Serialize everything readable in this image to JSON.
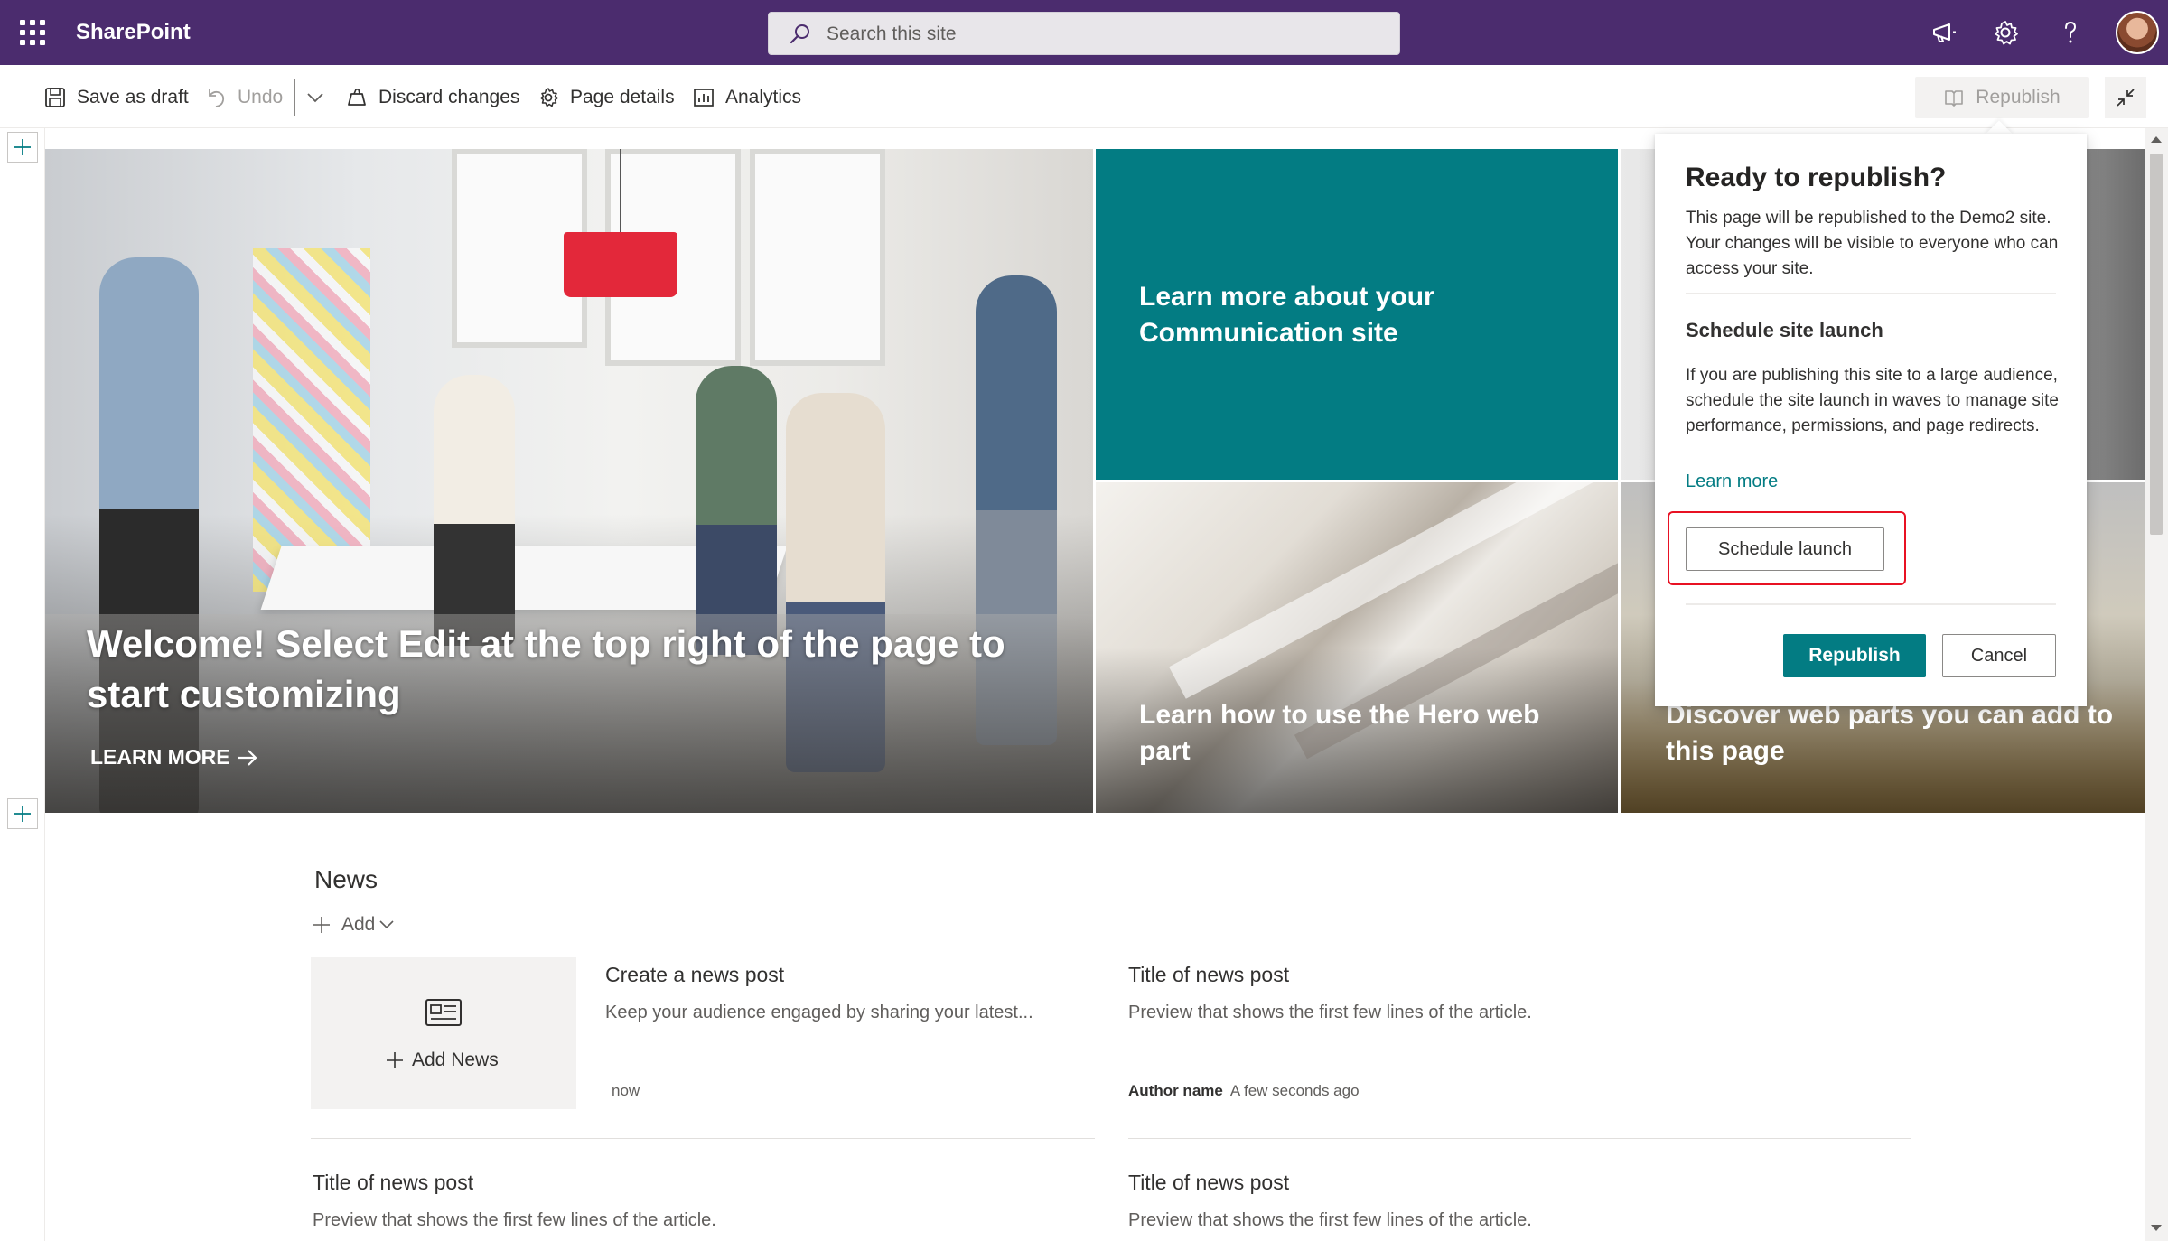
{
  "suite": {
    "app_name": "SharePoint",
    "search_placeholder": "Search this site",
    "icons": [
      "waffle-icon",
      "megaphone-icon",
      "gear-icon",
      "help-icon",
      "avatar"
    ]
  },
  "toolbar": {
    "save_draft": "Save as draft",
    "undo": "Undo",
    "discard": "Discard changes",
    "page_details": "Page details",
    "analytics": "Analytics",
    "republish": "Republish"
  },
  "hero": {
    "main_title": "Welcome! Select Edit at the top right of the page to start customizing",
    "main_link": "LEARN MORE",
    "tile_teal": "Learn more about your Communication site",
    "tile_arch": "Learn how to use the Hero web part",
    "tile_right": "Discover web parts you can add to this page"
  },
  "panel": {
    "title": "Ready to republish?",
    "description": "This page will be republished to the Demo2 site. Your changes will be visible to everyone who can access your site.",
    "section_title": "Schedule site launch",
    "section_body": "If you are publishing this site to a large audience, schedule the site launch in waves to manage site performance, permissions, and page redirects.",
    "learn_more": "Learn more",
    "schedule_button": "Schedule launch",
    "republish_button": "Republish",
    "cancel_button": "Cancel"
  },
  "news": {
    "title": "News",
    "add_label": "Add",
    "add_news_label": "Add News",
    "items": [
      {
        "title": "Create a news post",
        "preview": "Keep your audience engaged by sharing your latest...",
        "author": "",
        "time": "now"
      },
      {
        "title": "Title of news post",
        "preview": "Preview that shows the first few lines of the article.",
        "author": "Author name",
        "time": "A few seconds ago"
      },
      {
        "title": "Title of news post",
        "preview": "Preview that shows the first few lines of the article.",
        "author": "",
        "time": ""
      },
      {
        "title": "Title of news post",
        "preview": "Preview that shows the first few lines of the article.",
        "author": "",
        "time": ""
      }
    ]
  },
  "colors": {
    "suite_bar": "#4b2c6e",
    "accent_teal": "#037c83",
    "highlight_red": "#e81123"
  }
}
